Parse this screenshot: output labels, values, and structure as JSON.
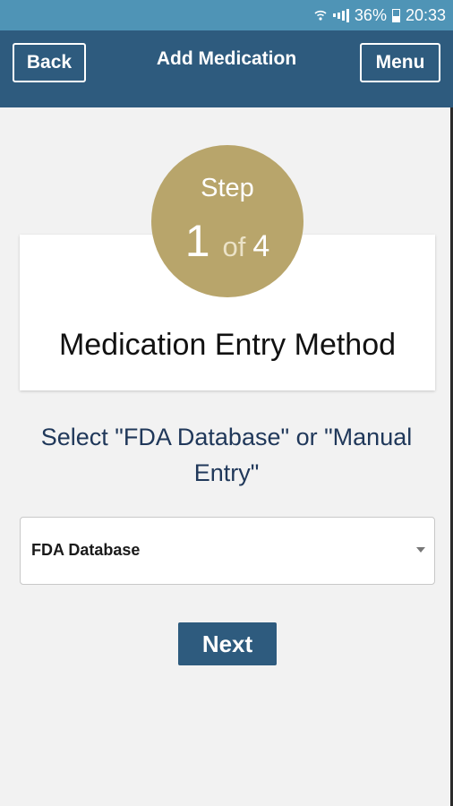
{
  "status_bar": {
    "battery": "36%",
    "time": "20:33",
    "icons": [
      "wifi-icon",
      "signal-icon",
      "battery-icon"
    ]
  },
  "header": {
    "back_label": "Back",
    "title": "Add Medication",
    "menu_label": "Menu"
  },
  "step": {
    "word": "Step",
    "current": "1",
    "of": "of",
    "total": "4"
  },
  "card": {
    "title": "Medication Entry Method"
  },
  "instruction": "Select \"FDA Database\" or \"Manual Entry\"",
  "entry_method": {
    "selected": "FDA Database"
  },
  "next_label": "Next",
  "colors": {
    "header": "#2e5b7e",
    "status_bar": "#4f94b6",
    "step_circle": "#b8a56b",
    "instruction_text": "#20385a",
    "background": "#f2f2f2"
  }
}
